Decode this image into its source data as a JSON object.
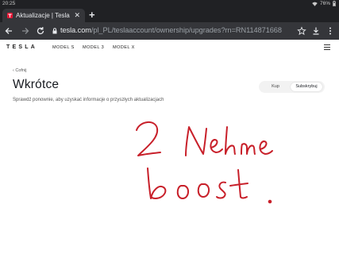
{
  "status_bar": {
    "time": "20:25",
    "battery": "76%"
  },
  "browser": {
    "tab_title": "Aktualizacje | Tesla",
    "new_tab_label": "+",
    "url_host": "tesla.com",
    "url_path": "/pl_PL/teslaaccount/ownership/upgrades?rn=RN114871668"
  },
  "site": {
    "logo": "TESLA",
    "nav": [
      "MODEL S",
      "MODEL 3",
      "MODEL X"
    ]
  },
  "page": {
    "back_label": "Cofnij",
    "title": "Wkrótce",
    "subtitle": "Sprawdź ponownie, aby uzyskać informacje o przyszłych aktualizacjach",
    "toggle_buy": "Kup",
    "toggle_subscribe": "Subskrybuj"
  },
  "colors": {
    "chrome_dark": "#202124",
    "chrome_toolbar": "#35363a",
    "handwriting": "#c8202a"
  }
}
